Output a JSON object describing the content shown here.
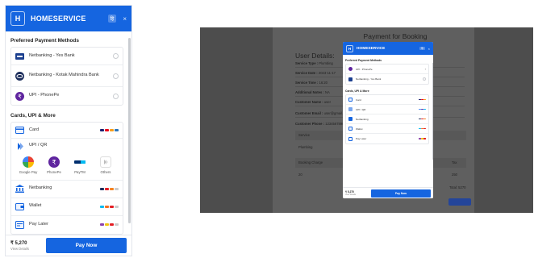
{
  "checkout": {
    "logo_letter": "H",
    "brand": "HOMESERVICE",
    "language_badge": "हि",
    "close_glyph": "×",
    "preferred_title": "Preferred Payment Methods",
    "preferred": [
      {
        "label": "Netbanking - Yes Bank",
        "icon": "bank-icon"
      },
      {
        "label": "Netbanking - Kotak Mahindra Bank",
        "icon": "kotak-bank-icon"
      },
      {
        "label": "UPI - PhonePe",
        "icon": "phonepe-icon"
      }
    ],
    "more_title": "Cards, UPI & More",
    "methods": {
      "card": "Card",
      "upi_qr": "UPI / QR",
      "upi_apps": [
        "Google Pay",
        "PhonePe",
        "PayTM",
        "Others"
      ],
      "netbanking": "Netbanking",
      "wallet": "Wallet",
      "pay_later": "Pay Later"
    },
    "amount": "₹ 5,270",
    "view_details": "View Details",
    "pay_button": "Pay Now"
  },
  "modal_preview": {
    "logo_letter": "H",
    "brand": "HOMESERVICE",
    "language_badge": "हि",
    "close_glyph": "×",
    "preferred_title": "Preferred Payment Methods",
    "preferred": [
      "UPI - PhonePe",
      "Netbanking - Yes Bank"
    ],
    "more_title": "Cards, UPI & More",
    "methods": [
      "Card",
      "UPI / QR",
      "Netbanking",
      "Wallet",
      "Pay Later"
    ],
    "amount": "₹ 5,270",
    "view_details": "View Details",
    "pay_button": "Pay Now"
  },
  "background_page": {
    "title": "Payment for Booking",
    "heading": "User Details:",
    "fields": [
      {
        "label": "Service Type :",
        "value": "Plumbing"
      },
      {
        "label": "Service Date :",
        "value": "2023-11-17"
      },
      {
        "label": "Service Time :",
        "value": "16:20"
      },
      {
        "label": "Additional Notes :",
        "value": "NA"
      },
      {
        "label": "Customer Name :",
        "value": "user"
      },
      {
        "label": "Customer Email :",
        "value": "user@gmail.com"
      },
      {
        "label": "Customer Phone :",
        "value": "1234567890"
      }
    ],
    "service_header": "Service",
    "service_value": "Plumbing",
    "booking_charge_header": "Booking Charge",
    "booking_charge_value": "20",
    "tax_header": "Tax",
    "tax_value": "250",
    "total": "Total: 5270"
  },
  "colors": {
    "brand_blue": "#1565e0",
    "overlay": "#4d4d4d"
  }
}
